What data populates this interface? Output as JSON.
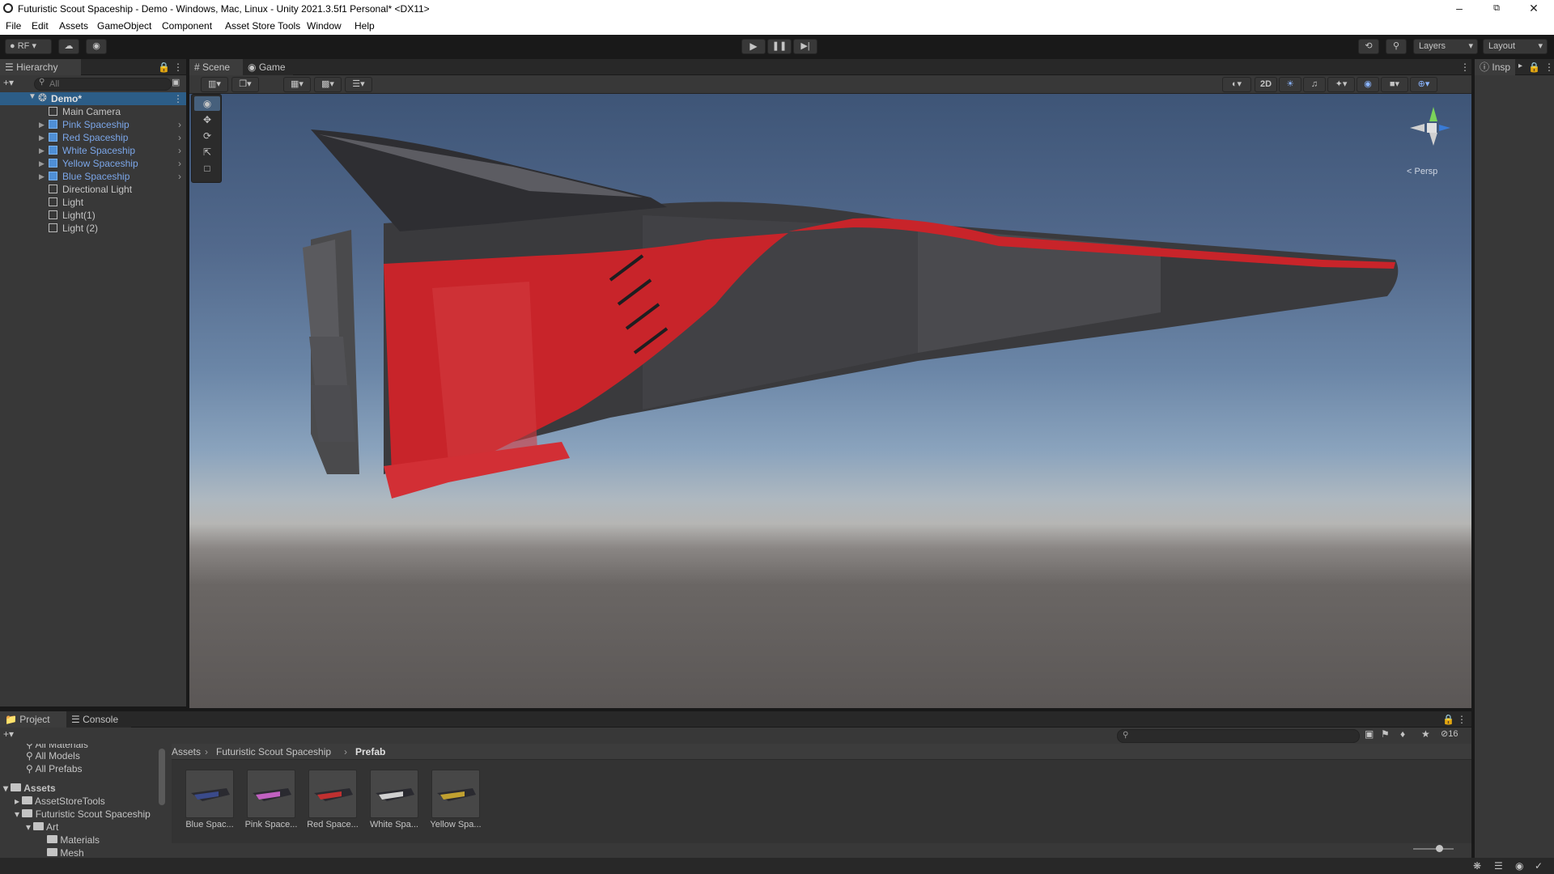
{
  "window": {
    "title": "Futuristic Scout Spaceship - Demo - Windows, Mac, Linux - Unity 2021.3.5f1 Personal* <DX11>"
  },
  "menu": [
    "File",
    "Edit",
    "Assets",
    "GameObject",
    "Component",
    "Asset Store Tools",
    "Window",
    "Help"
  ],
  "toolbar": {
    "account_label": "RF",
    "layers_label": "Layers",
    "layout_label": "Layout"
  },
  "hierarchy": {
    "tab_label": "Hierarchy",
    "search_placeholder": "All",
    "scene_name": "Demo*",
    "items": [
      {
        "label": "Main Camera",
        "prefab": false
      },
      {
        "label": "Pink Spaceship",
        "prefab": true
      },
      {
        "label": "Red Spaceship",
        "prefab": true
      },
      {
        "label": "White Spaceship",
        "prefab": true
      },
      {
        "label": "Yellow Spaceship",
        "prefab": true
      },
      {
        "label": "Blue Spaceship",
        "prefab": true
      },
      {
        "label": "Directional Light",
        "prefab": false
      },
      {
        "label": "Light",
        "prefab": false
      },
      {
        "label": "Light(1)",
        "prefab": false
      },
      {
        "label": "Light (2)",
        "prefab": false
      }
    ]
  },
  "scene": {
    "tabs": [
      {
        "label": "Scene"
      },
      {
        "label": "Game"
      }
    ],
    "btn_2d": "2D",
    "persp_label": "Persp"
  },
  "inspector": {
    "tab_label": "Insp"
  },
  "project": {
    "tabs": [
      {
        "label": "Project"
      },
      {
        "label": "Console"
      }
    ],
    "favorites": [
      "All Materials",
      "All Models",
      "All Prefabs"
    ],
    "tree": [
      "Assets",
      "AssetStoreTools",
      "Futuristic Scout Spaceship",
      "Art",
      "Materials",
      "Mesh"
    ],
    "breadcrumb": [
      "Assets",
      "Futuristic Scout Spaceship",
      "Prefab"
    ],
    "assets": [
      {
        "label": "Blue Spac...",
        "accent": "#3a4a8a"
      },
      {
        "label": "Pink Space...",
        "accent": "#c060c0"
      },
      {
        "label": "Red Space...",
        "accent": "#c03030"
      },
      {
        "label": "White Spa...",
        "accent": "#d0d0d0"
      },
      {
        "label": "Yellow Spa...",
        "accent": "#c0a030"
      }
    ],
    "hidden_count": "16"
  },
  "colors": {
    "accent_blue": "#7ba6e8",
    "selected": "#2c5d87",
    "hull_red": "#c8242a",
    "hull_dark": "#3a3a3c"
  }
}
